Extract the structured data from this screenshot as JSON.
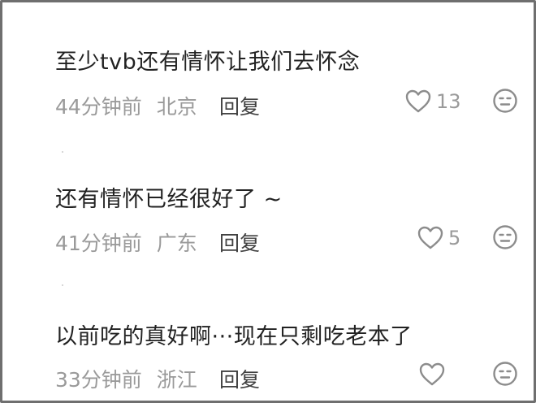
{
  "comments": [
    {
      "text": "至少tvb还有情怀让我们去怀念",
      "time": "44分钟前",
      "location": "北京",
      "reply_label": "回复",
      "likes": "13",
      "like_icon": "heart-outline-icon",
      "dislike_icon": "meh-face-icon"
    },
    {
      "text": "还有情怀已经很好了 ~",
      "time": "41分钟前",
      "location": "广东",
      "reply_label": "回复",
      "likes": "5",
      "like_icon": "heart-outline-icon",
      "dislike_icon": "meh-face-icon"
    },
    {
      "text": "以前吃的真好啊···现在只剩吃老本了",
      "time": "33分钟前",
      "location": "浙江",
      "reply_label": "回复",
      "likes": "",
      "like_icon": "heart-outline-icon",
      "dislike_icon": "meh-face-icon"
    }
  ],
  "colors": {
    "text": "#222222",
    "meta": "#9a9a9a",
    "reply": "#404040",
    "icon": "#8c8c8c",
    "border": "#6f6f6f"
  }
}
